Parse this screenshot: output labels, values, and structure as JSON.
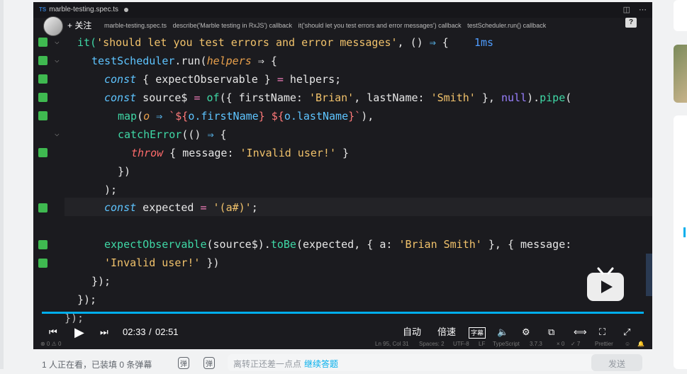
{
  "tab": {
    "badge": "TS",
    "title": "marble-testing.spec.ts"
  },
  "breadcrumbs": [
    "marble-testing.spec.ts",
    "describe('Marble testing in RxJS') callback",
    "it('should let you test errors and error messages') callback",
    "testScheduler.run() callback"
  ],
  "follow_label": "+ 关注",
  "help_label": "?",
  "code": {
    "l1_a": "it(",
    "l1_b": "'should let you test errors and error messages'",
    "l1_c": ", () ",
    "l1_d": "⇒",
    "l1_e": " {",
    "l1_badge": "1ms",
    "l2_a": "testScheduler",
    "l2_b": ".run(",
    "l2_c": "helpers",
    "l2_d": " ⇒ {",
    "l3_a": "const",
    "l3_b": " { expectObservable } ",
    "l3_c": "=",
    "l3_d": " helpers;",
    "l4_a": "const",
    "l4_b": " source$ ",
    "l4_c": "=",
    "l4_d": " of",
    "l4_e": "({ firstName: ",
    "l4_f": "'Brian'",
    "l4_g": ", lastName: ",
    "l4_h": "'Smith'",
    "l4_i": " }, ",
    "l4_j": "null",
    "l4_k": ").",
    "l4_l": "pipe",
    "l4_m": "(",
    "l5_a": "map",
    "l5_b": "(",
    "l5_c": "o",
    "l5_d": " ⇒ ",
    "l5_e": "`${",
    "l5_f": "o.firstName",
    "l5_g": "} ${",
    "l5_h": "o.lastName",
    "l5_i": "}`",
    "l5_j": "),",
    "l6_a": "catchError",
    "l6_b": "(() ",
    "l6_c": "⇒",
    "l6_d": " {",
    "l7_a": "throw",
    "l7_b": " { message: ",
    "l7_c": "'Invalid user!'",
    "l7_d": " }",
    "l8": "})",
    "l9": ");",
    "l10_a": "const",
    "l10_b": " expected ",
    "l10_c": "=",
    "l10_d": " '(a#)'",
    "l10_e": ";",
    "l12_a": "expectObservable",
    "l12_b": "(source$).",
    "l12_c": "toBe",
    "l12_d": "(expected, { a: ",
    "l12_e": "'Brian Smith'",
    "l12_f": " }, { message:",
    "l13_a": "'Invalid user!'",
    "l13_b": " })",
    "l14": "});",
    "l15": "});",
    "l16": "});"
  },
  "player": {
    "time_current": "02:33",
    "time_total": "02:51",
    "progress_fraction": 1.0,
    "auto_label": "自动",
    "speed_label": "倍速",
    "subtitle_label": "字幕"
  },
  "statusbar": {
    "problems": "⊗ 0 ⚠ 0",
    "position": "Ln 95, Col 31",
    "spaces": "Spaces: 2",
    "encoding": "UTF-8",
    "eol": "LF",
    "language": "TypeScript",
    "version": "3.7.3",
    "errors": "× 0",
    "checks": "✓ 7",
    "prettier": "Prettier"
  },
  "bottom": {
    "viewers": "1 人正在看，已装填 0 条弹幕",
    "dm_toggle": "弹",
    "dm_settings": "弹",
    "input_placeholder": "离转正还差一点点",
    "input_link": "继续答题",
    "send_label": "发送"
  },
  "colors": {
    "accent": "#00aeec",
    "gutter_added": "#3fb950"
  }
}
